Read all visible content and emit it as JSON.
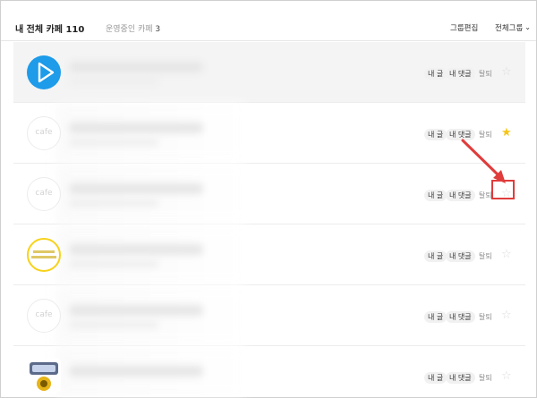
{
  "header": {
    "title": "내 전체 카페",
    "title_count": "110",
    "operating_label": "운영중인 카페",
    "operating_count": "3",
    "group_edit": "그룹편집",
    "all_groups": "전체그룹"
  },
  "rows": [
    {
      "thumb": "play-icon",
      "my_posts": "내 글",
      "my_comments": "내 댓글",
      "leave": "탈퇴",
      "favorite": false
    },
    {
      "thumb": "cafe",
      "thumb_text": "cafe",
      "my_posts": "내 글",
      "my_comments": "내 댓글",
      "leave": "탈퇴",
      "favorite": true
    },
    {
      "thumb": "cafe",
      "thumb_text": "cafe",
      "my_posts": "내 글",
      "my_comments": "내 댓글",
      "leave": "탈퇴",
      "favorite": false
    },
    {
      "thumb": "yellow-logo",
      "my_posts": "내 글",
      "my_comments": "내 댓글",
      "leave": "탈퇴",
      "favorite": false
    },
    {
      "thumb": "cafe",
      "thumb_text": "cafe",
      "my_posts": "내 글",
      "my_comments": "내 댓글",
      "leave": "탈퇴",
      "favorite": false
    },
    {
      "thumb": "badge-logo",
      "my_posts": "내 글",
      "my_comments": "내 댓글",
      "leave": "탈퇴",
      "favorite": false
    }
  ],
  "colors": {
    "accent_blue": "#1e9be9",
    "star_on": "#f5c518",
    "annotation_red": "#e03c3c"
  }
}
